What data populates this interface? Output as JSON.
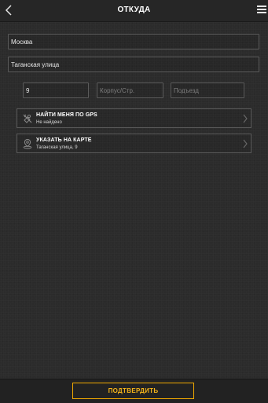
{
  "header": {
    "title": "ОТКУДА",
    "back_icon": "chevron-left-icon",
    "menu_icon": "hamburger-menu-icon"
  },
  "address": {
    "city_value": "Москва",
    "street_value": "Таганская улица",
    "house_value": "9",
    "building_placeholder": "Корпус/Стр.",
    "entrance_placeholder": "Подъезд"
  },
  "options": {
    "gps": {
      "title": "НАЙТИ МЕНЯ ПО GPS",
      "subtitle": "Не найдено",
      "icon": "gps-disabled-icon"
    },
    "map": {
      "title": "УКАЗАТЬ НА КАРТЕ",
      "subtitle": "Таганская улица, 9",
      "icon": "map-pin-icon"
    }
  },
  "footer": {
    "confirm_label": "ПОДТВЕРДИТЬ"
  },
  "colors": {
    "background": "#2b2b2b",
    "accent": "#f4b41a",
    "border": "#5a5a5a"
  }
}
